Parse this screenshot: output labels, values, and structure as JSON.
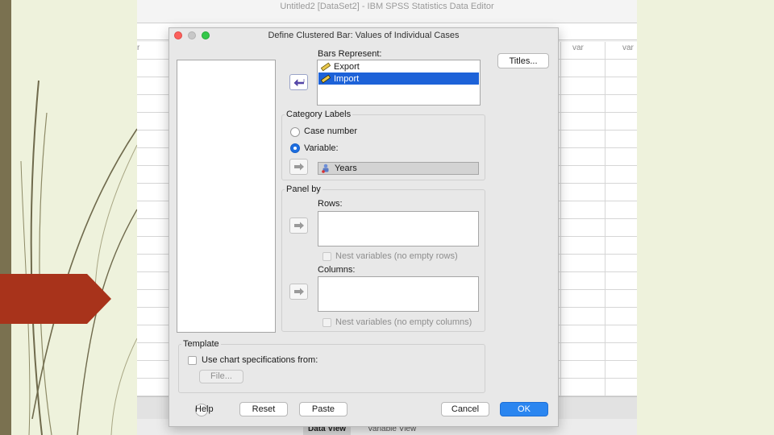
{
  "editor": {
    "window_title": "Untitled2 [DataSet2] - IBM SPSS Statistics Data Editor",
    "column_headers": [
      "r",
      "var",
      "var"
    ],
    "tabs": [
      "Data View",
      "Variable View"
    ]
  },
  "dialog": {
    "title": "Define Clustered Bar: Values of Individual Cases",
    "titles_button": "Titles...",
    "bars_represent": {
      "label": "Bars Represent:",
      "items": [
        {
          "label": "Export",
          "selected": false,
          "icon": "scale-ruler-icon"
        },
        {
          "label": "Import",
          "selected": true,
          "icon": "scale-ruler-icon"
        }
      ]
    },
    "category_labels": {
      "group_label": "Category Labels",
      "case_number_label": "Case number",
      "variable_label": "Variable:",
      "variable_value": "Years",
      "variable_icon": "nominal-person-icon",
      "selected": "variable"
    },
    "panel_by": {
      "group_label": "Panel by",
      "rows_label": "Rows:",
      "nest_rows_label": "Nest variables (no empty rows)",
      "columns_label": "Columns:",
      "nest_columns_label": "Nest variables (no empty columns)"
    },
    "template": {
      "group_label": "Template",
      "use_spec_label": "Use chart specifications from:",
      "file_button": "File..."
    },
    "footer": {
      "help": "Help",
      "reset": "Reset",
      "paste": "Paste",
      "cancel": "Cancel",
      "ok": "OK"
    }
  },
  "colors": {
    "accent": "#2b86f0",
    "selection": "#1d62d8",
    "slide_arrow": "#a8331b",
    "slide_background": "#eef2dc"
  }
}
